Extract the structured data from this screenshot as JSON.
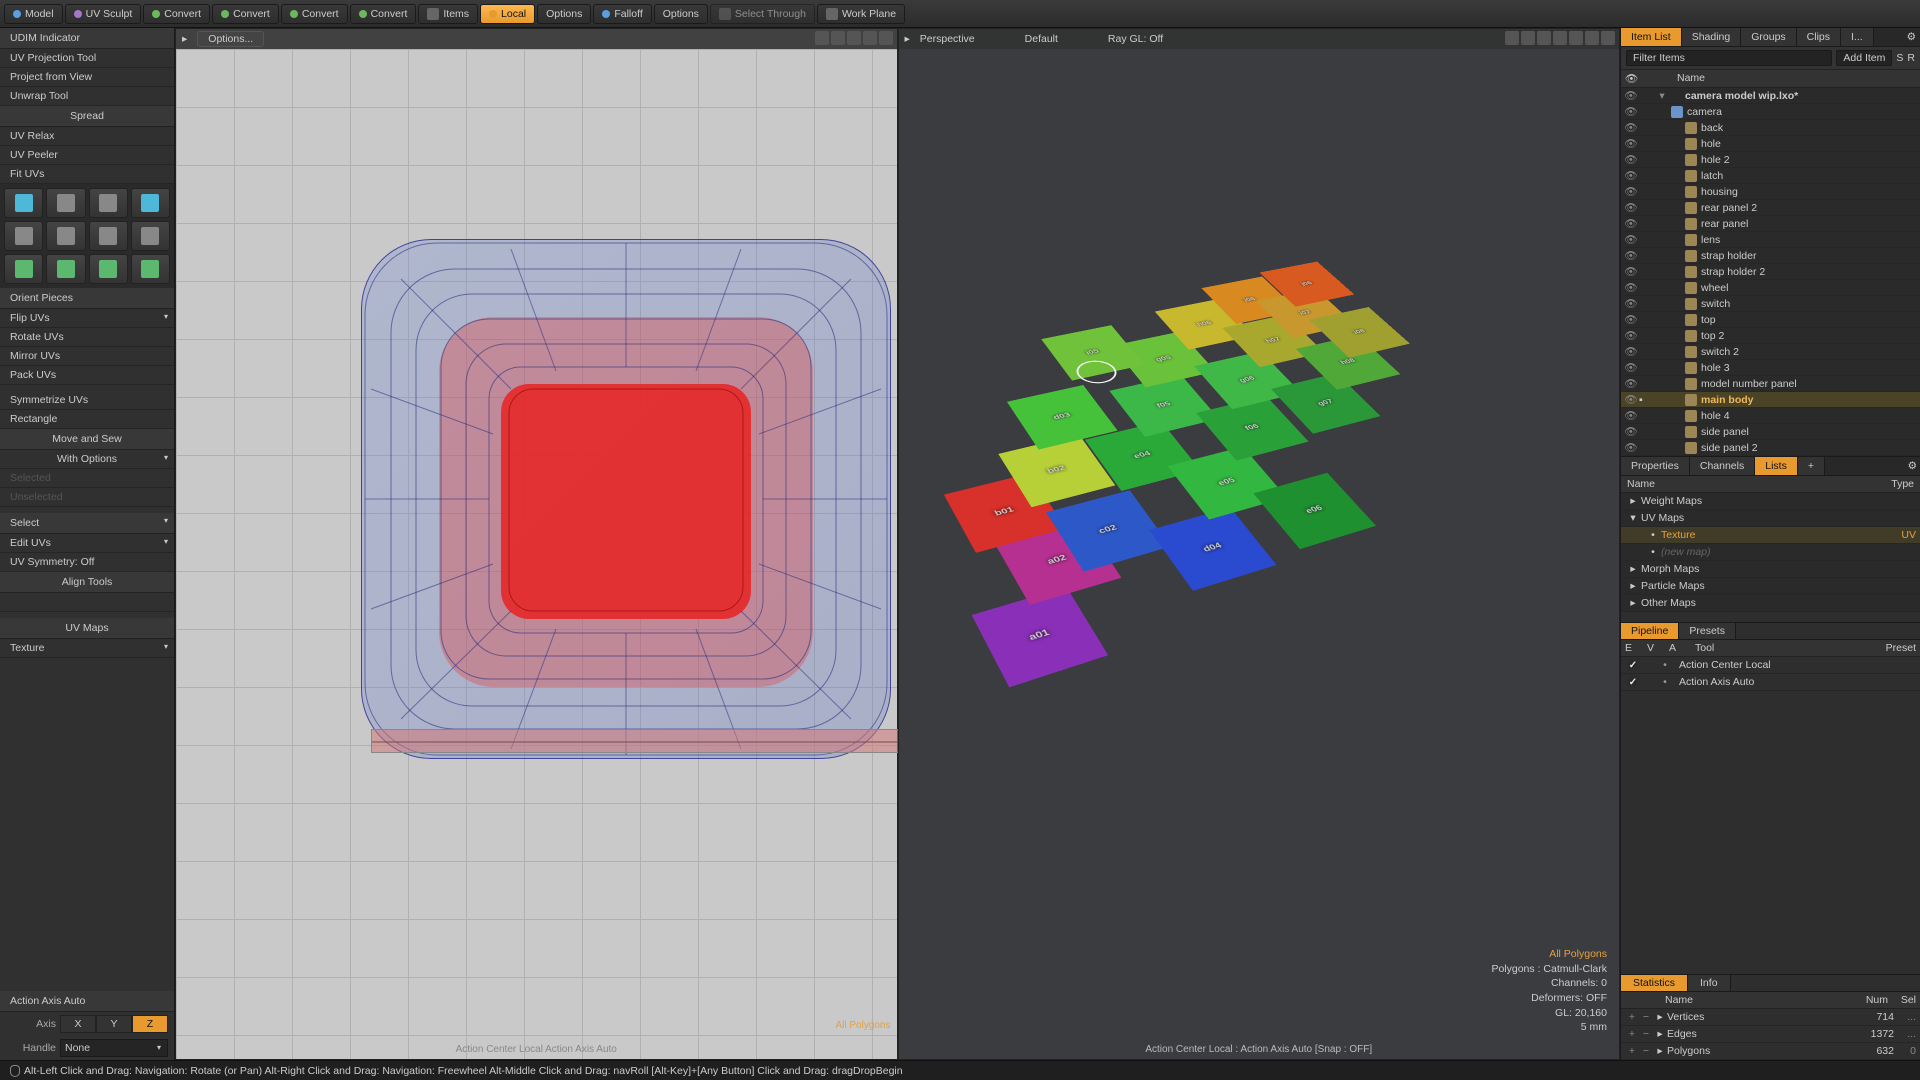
{
  "topbar": {
    "model": "Model",
    "uvsculpt": "UV Sculpt",
    "group_convert": [
      "Convert",
      "Convert",
      "Convert",
      "Convert"
    ],
    "items": "Items",
    "local": "Local",
    "options": "Options",
    "falloff": "Falloff",
    "options2": "Options",
    "select": "Select Through",
    "workplane": "Work Plane"
  },
  "left": {
    "udim": "UDIM Indicator",
    "tools": [
      "UV Projection Tool",
      "Project from View",
      "Unwrap Tool"
    ],
    "spread": "Spread",
    "spread_items": [
      "UV Relax",
      "UV Peeler",
      "Fit UVs"
    ],
    "orient": "Orient Pieces",
    "orient_items": [
      "Flip UVs",
      "Rotate UVs",
      "Mirror UVs",
      "Pack UVs"
    ],
    "sym": "Symmetrize UVs",
    "rect": "Rectangle",
    "movesew": "Move and Sew",
    "withopt": "With Options",
    "dis1": "Selected",
    "dis2": "Unselected",
    "selhead": "Select",
    "edituv": "Edit UVs",
    "uvsym": "UV Symmetry: Off",
    "align": "Align Tools",
    "uvmaps": "UV Maps",
    "texture": "Texture",
    "axis_label": "Action Axis Auto",
    "axis_lab": "Axis",
    "axes": [
      "X",
      "Y",
      "Z"
    ],
    "handle_lab": "Handle",
    "handle_val": "None"
  },
  "vp_left": {
    "options": "Options...",
    "allpoly": "All Polygons",
    "status": "Action Center Local   Action Axis Auto"
  },
  "vp_right": {
    "persp": "Perspective",
    "default": "Default",
    "raygl": "Ray GL: Off",
    "labels": [
      "a01",
      "a02",
      "b01",
      "b02",
      "c02",
      "d03",
      "d04",
      "e04",
      "e05",
      "e06",
      "f05",
      "f06",
      "g05",
      "g06",
      "g07",
      "h06",
      "h07",
      "h08",
      "i05",
      "i06",
      "i07",
      "i08",
      "j06"
    ],
    "overlay": {
      "allp": "All Polygons",
      "poly": "Polygons : Catmull-Clark",
      "chan": "Channels: 0",
      "def": "Deformers: OFF",
      "gl": "GL: 20,160",
      "mm": "5 mm"
    },
    "status": "Action Center Local : Action Axis Auto  [Snap : OFF]"
  },
  "right": {
    "tabs": [
      "Item List",
      "Shading",
      "Groups",
      "Clips",
      "I..."
    ],
    "filter": "Filter Items",
    "additem": "Add Item",
    "namehdr": "Name",
    "tree": [
      {
        "lvl": 0,
        "name": "camera model wip.lxo*",
        "scene": true,
        "exp": "▾"
      },
      {
        "lvl": 1,
        "name": "camera",
        "ic": "grp",
        "exp": "▾"
      },
      {
        "lvl": 2,
        "name": "back",
        "ic": "msh",
        "exp": "▸"
      },
      {
        "lvl": 2,
        "name": "hole",
        "ic": "msh"
      },
      {
        "lvl": 2,
        "name": "hole 2",
        "ic": "msh"
      },
      {
        "lvl": 2,
        "name": "latch",
        "ic": "msh"
      },
      {
        "lvl": 2,
        "name": "housing",
        "ic": "msh"
      },
      {
        "lvl": 2,
        "name": "rear panel 2",
        "ic": "msh"
      },
      {
        "lvl": 2,
        "name": "rear panel",
        "ic": "msh"
      },
      {
        "lvl": 2,
        "name": "lens",
        "ic": "msh",
        "exp": "▸"
      },
      {
        "lvl": 2,
        "name": "strap holder",
        "ic": "msh"
      },
      {
        "lvl": 2,
        "name": "strap holder 2",
        "ic": "msh"
      },
      {
        "lvl": 2,
        "name": "wheel",
        "ic": "msh"
      },
      {
        "lvl": 2,
        "name": "switch",
        "ic": "msh"
      },
      {
        "lvl": 2,
        "name": "top",
        "ic": "msh"
      },
      {
        "lvl": 2,
        "name": "top 2",
        "ic": "msh"
      },
      {
        "lvl": 2,
        "name": "switch 2",
        "ic": "msh"
      },
      {
        "lvl": 2,
        "name": "hole 3",
        "ic": "msh"
      },
      {
        "lvl": 2,
        "name": "model number panel",
        "ic": "msh"
      },
      {
        "lvl": 2,
        "name": "main body",
        "ic": "msh",
        "sel": true
      },
      {
        "lvl": 2,
        "name": "hole 4",
        "ic": "msh"
      },
      {
        "lvl": 2,
        "name": "side panel",
        "ic": "msh"
      },
      {
        "lvl": 2,
        "name": "side panel 2",
        "ic": "msh"
      }
    ],
    "tabs2": [
      "Properties",
      "Channels",
      "Lists",
      "+"
    ],
    "lists_hdr": {
      "name": "Name",
      "type": "Type"
    },
    "maps": [
      {
        "exp": "▸",
        "name": "Weight Maps"
      },
      {
        "exp": "▾",
        "name": "UV Maps",
        "open": true
      },
      {
        "child": true,
        "name": "Texture",
        "type": "UV",
        "sel": true
      },
      {
        "child": true,
        "name": "(new map)",
        "dim": true
      },
      {
        "exp": "▸",
        "name": "Morph Maps"
      },
      {
        "exp": "▸",
        "name": "Particle Maps"
      },
      {
        "exp": "▸",
        "name": "Other Maps"
      }
    ],
    "pipeline": {
      "tab1": "Pipeline",
      "tab2": "Presets",
      "hdr": [
        "E",
        "V",
        "A",
        "Tool",
        "Preset"
      ],
      "rows": [
        {
          "e": "✓",
          "v": "",
          "a": "•",
          "tool": "Action Center Local"
        },
        {
          "e": "✓",
          "v": "",
          "a": "•",
          "tool": "Action Axis Auto"
        }
      ]
    },
    "stats": {
      "tab1": "Statistics",
      "tab2": "Info",
      "hdr": {
        "name": "Name",
        "num": "Num",
        "sel": "Sel"
      },
      "rows": [
        {
          "name": "Vertices",
          "num": "714",
          "sel": "..."
        },
        {
          "name": "Edges",
          "num": "1372",
          "sel": "..."
        },
        {
          "name": "Polygons",
          "num": "632",
          "sel": "0"
        }
      ]
    }
  },
  "hintbar": "Alt-Left Click and Drag: Navigation: Rotate (or Pan)    Alt-Right Click and Drag: Navigation: Freewheel    Alt-Middle Click and Drag: navRoll    [Alt-Key]+[Any Button] Click and Drag: dragDropBegin"
}
